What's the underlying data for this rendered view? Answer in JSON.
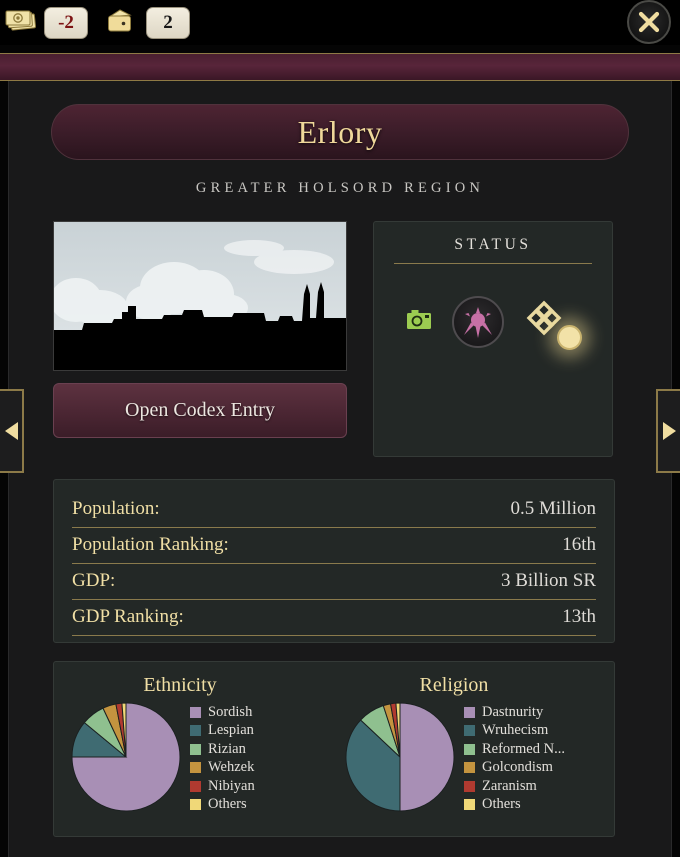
{
  "topbar": {
    "resources": [
      {
        "icon": "money-stack-icon",
        "value": "-2",
        "tone": "negative"
      },
      {
        "icon": "wallet-icon",
        "value": "2",
        "tone": "positive"
      }
    ],
    "close_label": "close-icon"
  },
  "nav": {
    "prev": "previous-region",
    "next": "next-region"
  },
  "header": {
    "title": "Erlory",
    "subtitle": "GREATER HOLSORD REGION"
  },
  "codex": {
    "button_label": "Open Codex Entry"
  },
  "status": {
    "title": "STATUS",
    "icons": [
      {
        "name": "camera-icon",
        "color": "#9ac košt"
      },
      {
        "name": "sun-emblem-icon",
        "color": "#c770a6"
      },
      {
        "name": "knot-emblem-icon",
        "color": "#e8d9a0"
      }
    ]
  },
  "stats": [
    {
      "label": "Population:",
      "value": "0.5 Million"
    },
    {
      "label": "Population Ranking:",
      "value": "16th"
    },
    {
      "label": "GDP:",
      "value": "3 Billion SR"
    },
    {
      "label": "GDP Ranking:",
      "value": "13th"
    }
  ],
  "chart_data": [
    {
      "type": "pie",
      "title": "Ethnicity",
      "categories": [
        "Sordish",
        "Lespian",
        "Rizian",
        "Wehzek",
        "Nibiyan",
        "Others"
      ],
      "values": [
        75,
        11,
        7,
        4,
        1.8,
        1.2
      ],
      "colors": [
        "#a88fb5",
        "#3f6b72",
        "#8fc08f",
        "#c4943f",
        "#b03a30",
        "#f0d878"
      ],
      "legend_position": "right",
      "start_angle": -90
    },
    {
      "type": "pie",
      "title": "Religion",
      "categories": [
        "Dastnurity",
        "Wruhecism",
        "Reformed N...",
        "Golcondism",
        "Zaranism",
        "Others"
      ],
      "values": [
        50,
        37,
        8,
        2.2,
        1.6,
        1.2
      ],
      "colors": [
        "#a88fb5",
        "#3f6b72",
        "#8fc08f",
        "#c4943f",
        "#b03a30",
        "#f0d878"
      ],
      "legend_position": "right",
      "start_angle": -90
    }
  ],
  "theme": {
    "gold": "#f0dfa5",
    "maroon": "#4a1f30",
    "panel": "#19191a",
    "card": "#232826"
  }
}
